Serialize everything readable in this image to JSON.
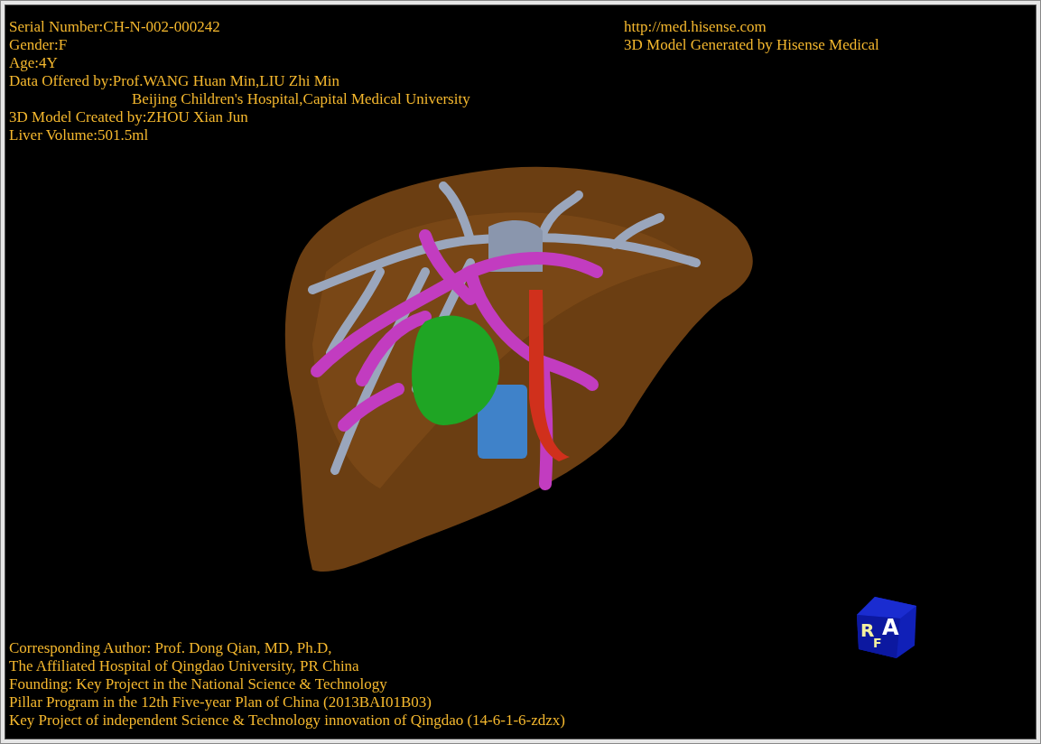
{
  "patient_info": [
    {
      "kind": "line",
      "text": "Serial Number:CH-N-002-000242"
    },
    {
      "kind": "line",
      "text": "Gender:F"
    },
    {
      "kind": "line",
      "text": "Age:4Y"
    },
    {
      "kind": "line",
      "text": "Data Offered by:Prof.WANG Huan Min,LIU Zhi Min"
    },
    {
      "kind": "continuation",
      "text": "Beijing Children's Hospital,Capital Medical University"
    },
    {
      "kind": "line",
      "text": "3D Model Created by:ZHOU Xian Jun"
    },
    {
      "kind": "line",
      "text": "Liver Volume:501.5ml"
    }
  ],
  "vendor_info": [
    "http://med.hisense.com",
    "3D Model Generated by Hisense Medical"
  ],
  "credits": [
    "Corresponding Author: Prof. Dong Qian, MD, Ph.D,",
    "The Affiliated Hospital of Qingdao University, PR China",
    "Founding: Key Project in the National Science & Technology",
    "Pillar Program in the 12th Five-year Plan of China (2013BAI01B03)",
    "Key Project of independent Science & Technology innovation of Qingdao (14-6-1-6-zdzx)"
  ],
  "orientation_cube": {
    "left_face": "R",
    "front_face": "A",
    "bottom_face": "F"
  }
}
